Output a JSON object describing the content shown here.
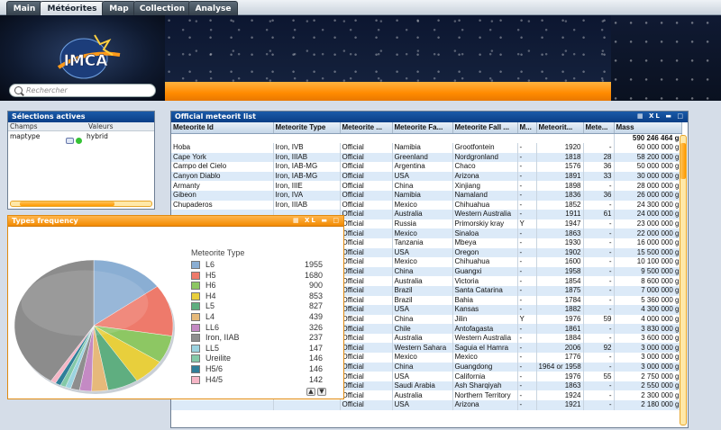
{
  "tabs": [
    {
      "label": "Main"
    },
    {
      "label": "Météorites"
    },
    {
      "label": "Map"
    },
    {
      "label": "Collection"
    },
    {
      "label": "Analyse"
    }
  ],
  "active_tab": "Météorites",
  "logo_text": "IMCA",
  "search": {
    "placeholder": "Rechercher"
  },
  "selections": {
    "title": "Sélections actives",
    "col_field": "Champs",
    "col_values": "Valeurs",
    "rows": [
      {
        "field": "maptype",
        "value": "hybrid"
      }
    ]
  },
  "table": {
    "title": "Official meteorit list",
    "controls": "XL",
    "total_mass": "590 246 464 g",
    "headers": [
      "Meteorite Id",
      "Meteorite Type",
      "Meteorite ...",
      "Meteorite Fa...",
      "Meteorite Fall ...",
      "M...",
      "Meteorit...",
      "Mete...",
      "Mass"
    ],
    "rows": [
      [
        "Hoba",
        "Iron, IVB",
        "Official",
        "Namibia",
        "Grootfontein",
        "-",
        "1920",
        "-",
        "60 000 000 g"
      ],
      [
        "Cape York",
        "Iron, IIIAB",
        "Official",
        "Greenland",
        "Nordgronland",
        "-",
        "1818",
        "28",
        "58 200 000 g"
      ],
      [
        "Campo del Cielo",
        "Iron, IAB-MG",
        "Official",
        "Argentina",
        "Chaco",
        "-",
        "1576",
        "36",
        "50 000 000 g"
      ],
      [
        "Canyon Diablo",
        "Iron, IAB-MG",
        "Official",
        "USA",
        "Arizona",
        "-",
        "1891",
        "33",
        "30 000 000 g"
      ],
      [
        "Armanty",
        "Iron, IIIE",
        "Official",
        "China",
        "Xinjiang",
        "-",
        "1898",
        "-",
        "28 000 000 g"
      ],
      [
        "Gibeon",
        "Iron, IVA",
        "Official",
        "Namibia",
        "Namaland",
        "-",
        "1836",
        "36",
        "26 000 000 g"
      ],
      [
        "Chupaderos",
        "Iron, IIIAB",
        "Official",
        "Mexico",
        "Chihuahua",
        "-",
        "1852",
        "-",
        "24 300 000 g"
      ],
      [
        "",
        "",
        "Official",
        "Australia",
        "Western Australia",
        "-",
        "1911",
        "61",
        "24 000 000 g"
      ],
      [
        "",
        "",
        "Official",
        "Russia",
        "Primorskiy kray",
        "Y",
        "1947",
        "-",
        "23 000 000 g"
      ],
      [
        "",
        "",
        "Official",
        "Mexico",
        "Sinaloa",
        "-",
        "1863",
        "-",
        "22 000 000 g"
      ],
      [
        "",
        "",
        "Official",
        "Tanzania",
        "Mbeya",
        "-",
        "1930",
        "-",
        "16 000 000 g"
      ],
      [
        "",
        "",
        "Official",
        "USA",
        "Oregon",
        "-",
        "1902",
        "-",
        "15 500 000 g"
      ],
      [
        "",
        "",
        "Official",
        "Mexico",
        "Chihuahua",
        "-",
        "1600",
        "-",
        "10 100 000 g"
      ],
      [
        "",
        "",
        "Official",
        "China",
        "Guangxi",
        "-",
        "1958",
        "-",
        "9 500 000 g"
      ],
      [
        "",
        "",
        "Official",
        "Australia",
        "Victoria",
        "-",
        "1854",
        "-",
        "8 600 000 g"
      ],
      [
        "",
        "",
        "Official",
        "Brazil",
        "Santa Catarina",
        "-",
        "1875",
        "-",
        "7 000 000 g"
      ],
      [
        "",
        "",
        "Official",
        "Brazil",
        "Bahia",
        "-",
        "1784",
        "-",
        "5 360 000 g"
      ],
      [
        "",
        "",
        "Official",
        "USA",
        "Kansas",
        "-",
        "1882",
        "-",
        "4 300 000 g"
      ],
      [
        "",
        "",
        "Official",
        "China",
        "Jilin",
        "Y",
        "1976",
        "59",
        "4 000 000 g"
      ],
      [
        "",
        "",
        "Official",
        "Chile",
        "Antofagasta",
        "-",
        "1861",
        "-",
        "3 830 000 g"
      ],
      [
        "",
        "",
        "Official",
        "Australia",
        "Western Australia",
        "-",
        "1884",
        "-",
        "3 600 000 g"
      ],
      [
        "",
        "",
        "Official",
        "Western Sahara",
        "Saguia el Hamra",
        "-",
        "2006",
        "92",
        "3 000 000 g"
      ],
      [
        "",
        "",
        "Official",
        "Mexico",
        "Mexico",
        "-",
        "1776",
        "-",
        "3 000 000 g"
      ],
      [
        "",
        "",
        "Official",
        "China",
        "Guangdong",
        "-",
        "1964 or 1958",
        "-",
        "3 000 000 g"
      ],
      [
        "",
        "",
        "Official",
        "USA",
        "California",
        "-",
        "1976",
        "55",
        "2 750 000 g"
      ],
      [
        "",
        "",
        "Official",
        "Saudi Arabia",
        "Ash Sharqiyah",
        "-",
        "1863",
        "-",
        "2 550 000 g"
      ],
      [
        "",
        "",
        "Official",
        "Australia",
        "Northern Territory",
        "-",
        "1924",
        "-",
        "2 300 000 g"
      ],
      [
        "",
        "",
        "Official",
        "USA",
        "Arizona",
        "-",
        "1921",
        "-",
        "2 180 000 g"
      ]
    ]
  },
  "types_panel": {
    "title": "Types frequency",
    "controls": "XL"
  },
  "chart_data": {
    "type": "pie",
    "title": "",
    "legend_title": "Meteorite Type",
    "legend_placement": "right",
    "categories": [
      "L6",
      "H5",
      "H6",
      "H4",
      "L5",
      "L4",
      "LL6",
      "Iron, IIAB",
      "LL5",
      "Ureilite",
      "H5/6",
      "H4/5"
    ],
    "values": [
      1955,
      1680,
      900,
      853,
      827,
      439,
      326,
      237,
      147,
      146,
      146,
      142
    ],
    "colors": [
      "#8aaed3",
      "#ee7a6b",
      "#8dc763",
      "#e8cf3c",
      "#5fae80",
      "#e6b97a",
      "#c48ac4",
      "#8e8e8e",
      "#9cd3e0",
      "#84c9a8",
      "#2f7f99",
      "#f5b6c6"
    ],
    "other_count": 5400,
    "other_color": "#8c8c8c"
  }
}
